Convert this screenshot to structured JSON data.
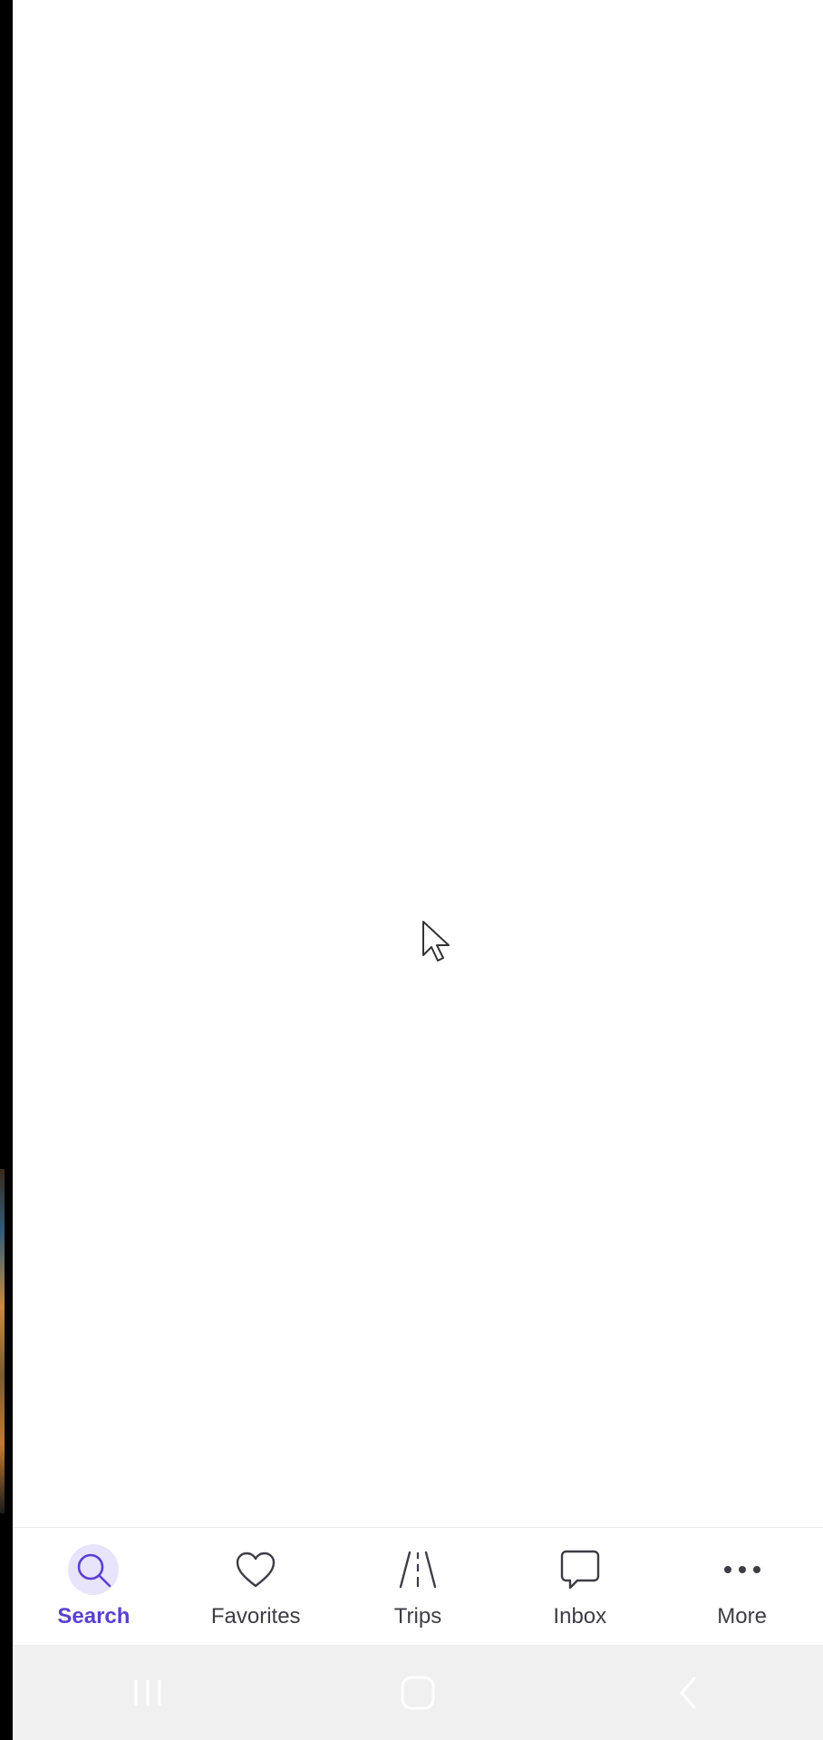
{
  "tabbar": {
    "tabs": [
      {
        "label": "Search",
        "icon": "search-icon",
        "active": true
      },
      {
        "label": "Favorites",
        "icon": "heart-icon",
        "active": false
      },
      {
        "label": "Trips",
        "icon": "road-icon",
        "active": false
      },
      {
        "label": "Inbox",
        "icon": "chat-bubble-icon",
        "active": false
      },
      {
        "label": "More",
        "icon": "more-dots-icon",
        "active": false
      }
    ]
  },
  "navbar": {
    "buttons": [
      "recent-apps-icon",
      "home-icon",
      "back-icon"
    ]
  },
  "colors": {
    "accent": "#5b3fd1",
    "accent_bg": "#e8e4fb",
    "text": "#3d3d45",
    "nav_bg": "#f0f0f0"
  }
}
